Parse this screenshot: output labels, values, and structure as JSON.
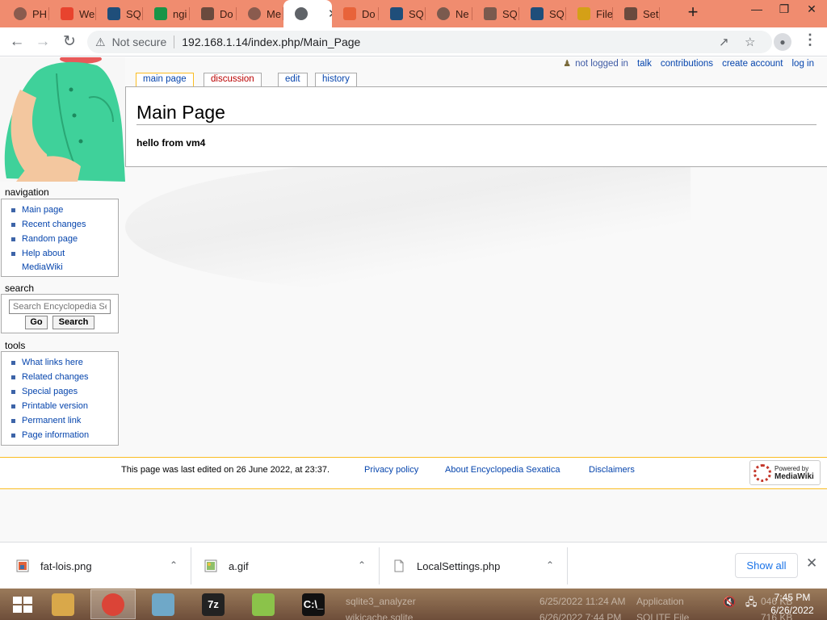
{
  "browser": {
    "tabs": [
      {
        "label": "PH",
        "icon": "globe-icon",
        "color": "#8a5b4e"
      },
      {
        "label": "We",
        "icon": "brand-icon",
        "color": "#e8432e"
      },
      {
        "label": "SQ",
        "icon": "sqlite-icon",
        "color": "#1f4e7a"
      },
      {
        "label": "ngi",
        "icon": "nginx-icon",
        "color": "#199447"
      },
      {
        "label": "Do",
        "icon": "download-icon",
        "color": "#6a4a3e"
      },
      {
        "label": "Me",
        "icon": "globe-icon",
        "color": "#8a5b4e"
      },
      {
        "label": "",
        "icon": "globe-icon",
        "color": "#5f6368",
        "active": true
      },
      {
        "label": "Do",
        "icon": "doc-icon",
        "color": "#e8633a"
      },
      {
        "label": "SQ",
        "icon": "sqlite-icon",
        "color": "#1f4e7a"
      },
      {
        "label": "Ne",
        "icon": "chrome-icon",
        "color": "#7a5a4e"
      },
      {
        "label": "SQ",
        "icon": "diamond-icon",
        "color": "#7a5a4e"
      },
      {
        "label": "SQ",
        "icon": "sqlite-icon",
        "color": "#1f4e7a"
      },
      {
        "label": "File",
        "icon": "folder-icon",
        "color": "#d4a017"
      },
      {
        "label": "Set",
        "icon": "gear-icon",
        "color": "#6a4a3e"
      }
    ],
    "address": {
      "security": "Not secure",
      "url": "192.168.1.14/index.php/Main_Page"
    }
  },
  "wiki": {
    "personal": {
      "anon": "not logged in",
      "links": [
        "talk",
        "contributions",
        "create account",
        "log in"
      ]
    },
    "content_tabs": {
      "main_page": "main page",
      "discussion": "discussion",
      "edit": "edit",
      "history": "history"
    },
    "page_title": "Main Page",
    "body_text": "hello from vm4",
    "navigation": {
      "heading": "navigation",
      "items": [
        "Main page",
        "Recent changes",
        "Random page",
        "Help about",
        "MediaWiki"
      ]
    },
    "search": {
      "heading": "search",
      "placeholder": "Search Encyclopedia Sexatica",
      "go_label": "Go",
      "search_label": "Search"
    },
    "tools": {
      "heading": "tools",
      "items": [
        "What links here",
        "Related changes",
        "Special pages",
        "Printable version",
        "Permanent link",
        "Page information"
      ]
    },
    "footer": {
      "last_edited": "This page was last edited on 26 June 2022, at 23:37.",
      "privacy": "Privacy policy",
      "about": "About Encyclopedia Sexatica",
      "disclaimers": "Disclaimers",
      "powered_line1": "Powered by",
      "powered_line2": "MediaWiki"
    }
  },
  "downloads": {
    "items": [
      {
        "name": "fat-lois.png"
      },
      {
        "name": "a.gif"
      },
      {
        "name": "LocalSettings.php"
      }
    ],
    "show_all": "Show all"
  },
  "taskbar": {
    "apps": [
      {
        "name": "file-explorer",
        "color": "#d9a84a"
      },
      {
        "name": "chrome",
        "color": "#db4437",
        "active": true
      },
      {
        "name": "notepad",
        "color": "#6fa8c8"
      },
      {
        "name": "7z",
        "color": "#222222",
        "label": "7z"
      },
      {
        "name": "notepad-plus-plus",
        "color": "#8bc34a"
      },
      {
        "name": "cmd",
        "color": "#111111",
        "label": "C:\\_"
      }
    ],
    "preview": {
      "row1_name": "sqlite3_analyzer",
      "row1_date": "6/25/2022 11:24 AM",
      "row1_type": "Application",
      "row1_size": "046 KB",
      "row2_name": "wikicache.sqlite",
      "row2_date": "6/26/2022 7:44 PM",
      "row2_type": "SQLITE File",
      "row2_size": "716 KB"
    },
    "time": "7:45 PM",
    "date": "6/26/2022"
  }
}
